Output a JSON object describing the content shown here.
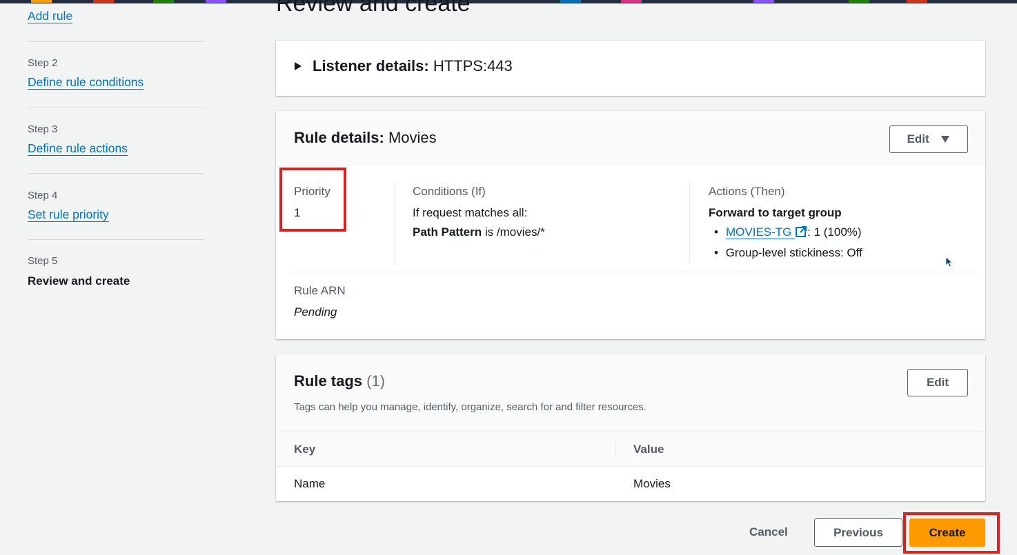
{
  "header": {
    "accent_colors": [
      "#ff9900",
      "#d13212",
      "#1d8102",
      "#8c4fff",
      "#0073bb",
      "#e02b83"
    ]
  },
  "steps": {
    "add_rule_label": "Add rule",
    "step2_label": "Step 2",
    "step2_link": "Define rule conditions",
    "step3_label": "Step 3",
    "step3_link": "Define rule actions",
    "step4_label": "Step 4",
    "step4_link": "Set rule priority",
    "step5_label": "Step 5",
    "step5_title": "Review and create"
  },
  "main": {
    "page_title": "Review and create",
    "listener": {
      "heading_bold": "Listener details:",
      "heading_value": "HTTPS:443"
    },
    "rule_details": {
      "heading_bold": "Rule details:",
      "heading_value": "Movies",
      "edit_label": "Edit",
      "priority_label": "Priority",
      "priority_value": "1",
      "conditions_label": "Conditions (If)",
      "conditions_line1": "If request matches all:",
      "conditions_path_bold": "Path Pattern",
      "conditions_path_rest": "is /movies/*",
      "actions_label": "Actions (Then)",
      "actions_title": "Forward to target group",
      "target_group_link": "MOVIES-TG",
      "target_group_weight": ": 1 (100%)",
      "stickiness": "Group-level stickiness: Off",
      "rule_arn_label": "Rule ARN",
      "rule_arn_value": "Pending"
    },
    "rule_tags": {
      "heading": "Rule tags",
      "count": "(1)",
      "edit_label": "Edit",
      "description": "Tags can help you manage, identify, organize, search for and filter resources.",
      "columns": [
        "Key",
        "Value"
      ],
      "rows": [
        [
          "Name",
          "Movies"
        ]
      ]
    }
  },
  "footer": {
    "cancel_label": "Cancel",
    "previous_label": "Previous",
    "create_label": "Create"
  },
  "icons": {
    "expand": "caret-right-icon",
    "dropdown": "caret-down-icon",
    "external": "external-link-icon",
    "cursor": "mouse-pointer-icon"
  }
}
